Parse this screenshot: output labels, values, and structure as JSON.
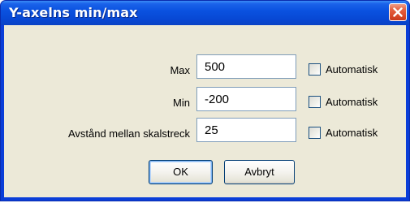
{
  "window": {
    "title": "Y-axelns min/max"
  },
  "rows": [
    {
      "label": "Max",
      "value": "500",
      "checkbox_label": "Automatisk",
      "checked": false
    },
    {
      "label": "Min",
      "value": "-200",
      "checkbox_label": "Automatisk",
      "checked": false
    },
    {
      "label": "Avstånd mellan skalstreck",
      "value": "25",
      "checkbox_label": "Automatisk",
      "checked": false
    }
  ],
  "buttons": {
    "ok_label": "OK",
    "cancel_label": "Avbryt"
  },
  "colors": {
    "titlebar": "#0a52e0",
    "close_button": "#d94a2a",
    "client_background": "#ece9d8",
    "field_border": "#7f9db9"
  }
}
